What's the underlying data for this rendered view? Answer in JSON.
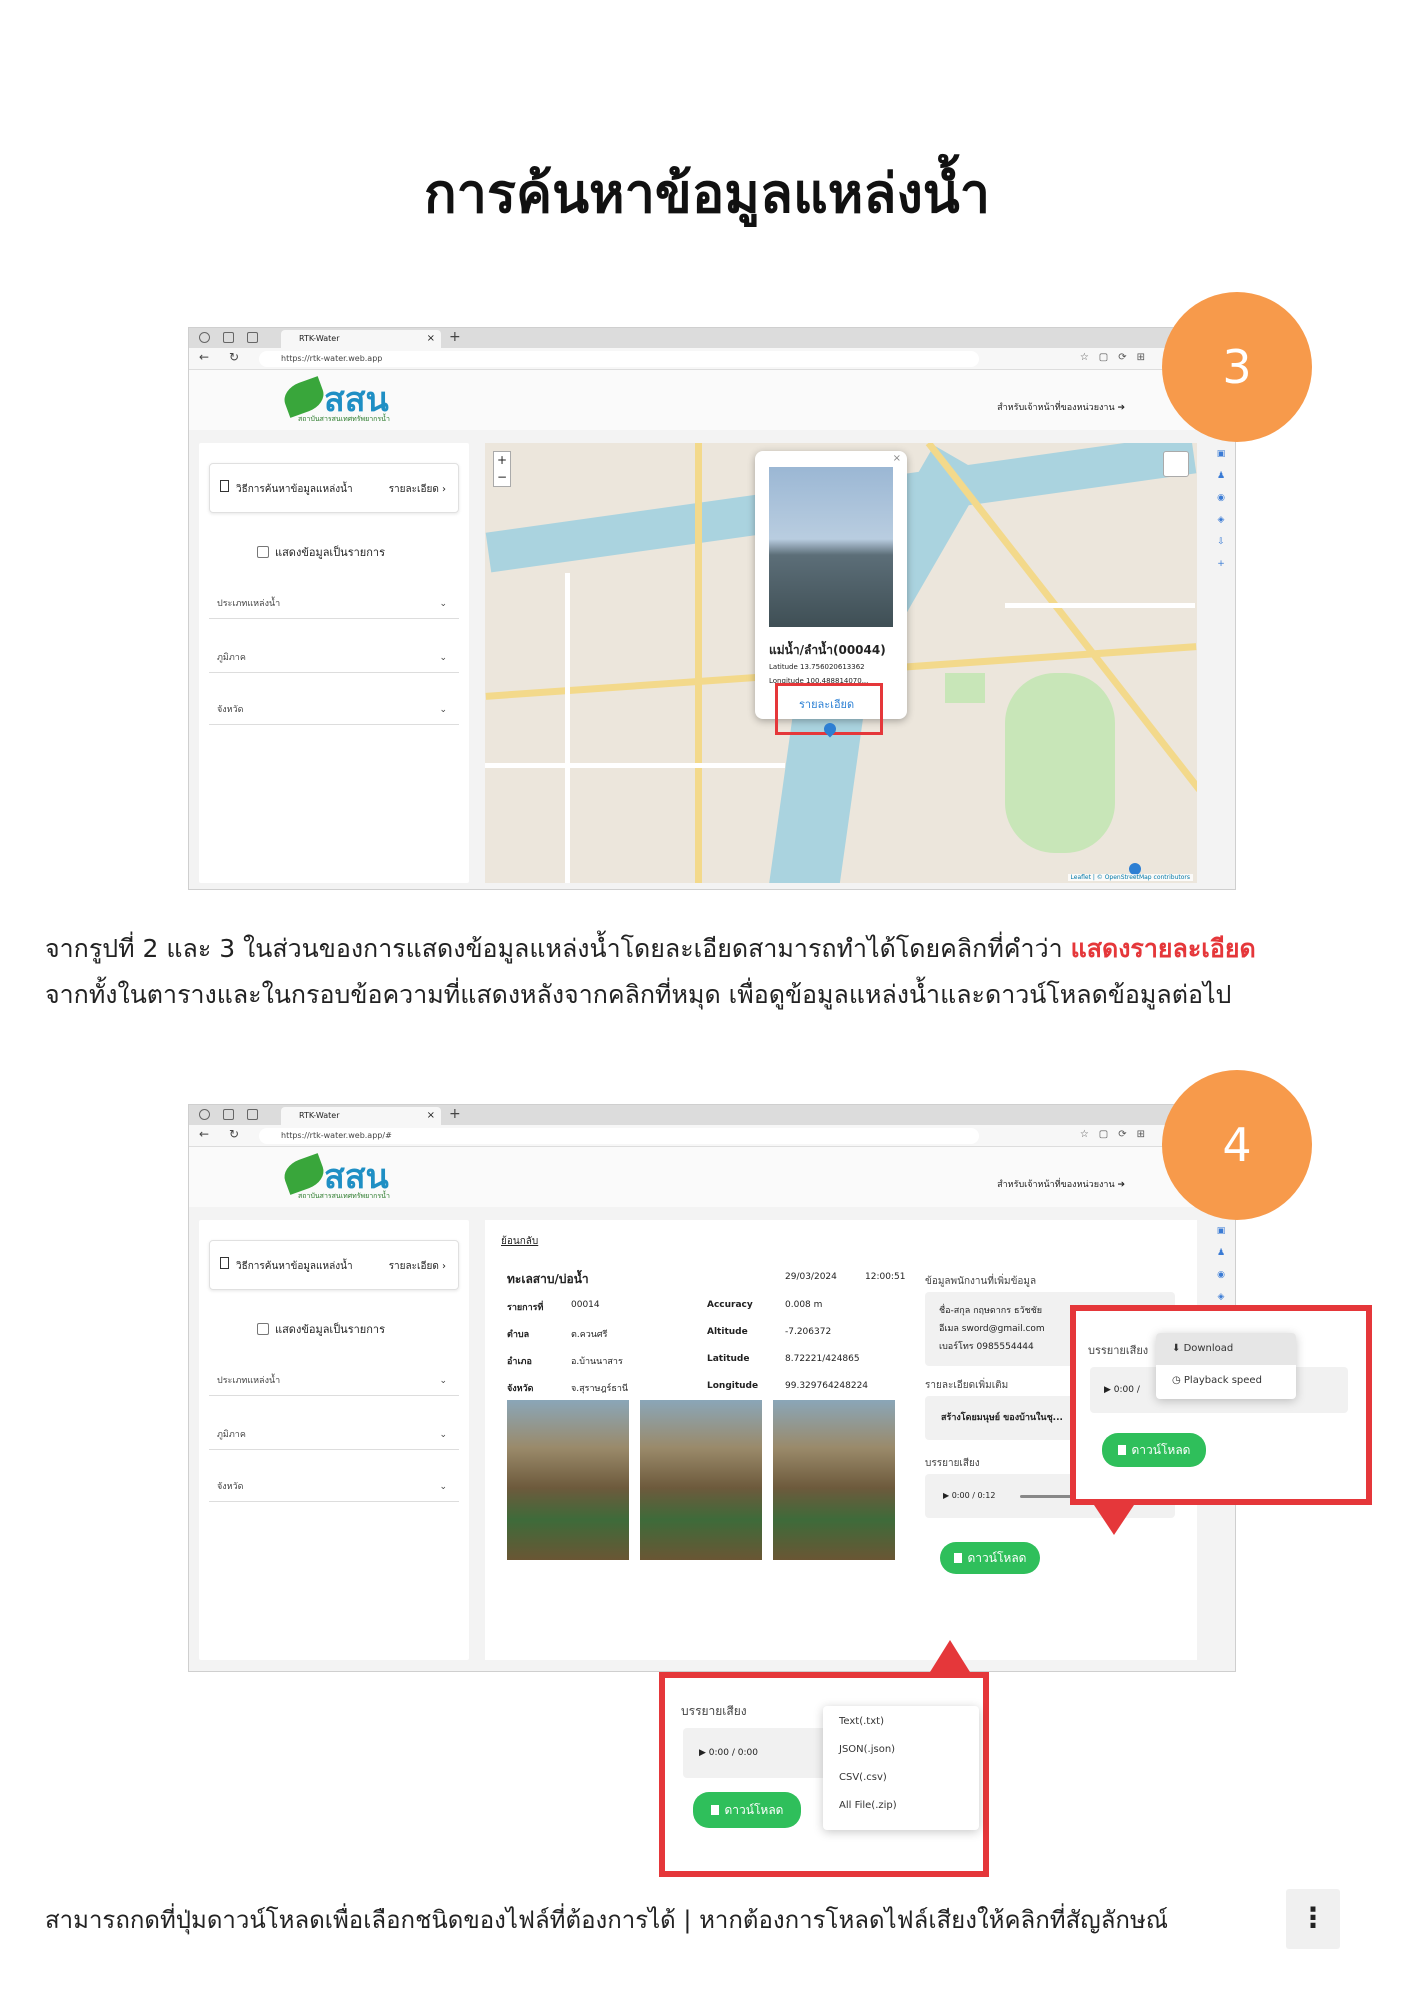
{
  "title": "การค้นหาข้อมูลแหล่งน้ำ",
  "browser": {
    "tab_title": "RTK-Water",
    "url1": "https://rtk-water.web.app",
    "url2": "https://rtk-water.web.app/#"
  },
  "app": {
    "logo_text": "สสน",
    "logo_sub": "สถาบันสารสนเทศทรัพยากรน้ำ",
    "staff_link": "สำหรับเจ้าหน้าที่ของหน่วยงาน",
    "method_label": "วิธีการค้นหาข้อมูลแหล่งน้ำ",
    "method_link": "รายละเอียด",
    "list_toggle": "แสดงข้อมูลเป็นรายการ",
    "selects": [
      "ประเภทแหล่งน้ำ",
      "ภูมิภาค",
      "จังหวัด"
    ]
  },
  "map": {
    "popup_title": "แม่น้ำ/ลำน้ำ(00044)",
    "latitude": "Latitude  13.756020613362",
    "longitude": "Longitude  100.488814070...",
    "detail_link": "รายละเอียด",
    "attribution": "Leaflet | © OpenStreetMap contributors"
  },
  "badges": [
    "3",
    "4"
  ],
  "paragraph1": {
    "text": "จากรูปที่ 2 และ 3 ในส่วนของการแสดงข้อมูลแหล่งน้ำโดยละเอียดสามารถทำได้โดยคลิกที่คำว่า ",
    "highlight": "แสดงรายละเอียด",
    "line2": "จากทั้งในตารางและในกรอบข้อความที่แสดงหลังจากคลิกที่หมุด เพื่อดูข้อมูลแหล่งน้ำและดาวน์โหลดข้อมูลต่อไป"
  },
  "detail": {
    "back": "ย้อนกลับ",
    "title": "ทะเลสาบ/บ่อน้ำ",
    "date": "29/03/2024",
    "time": "12:00:51",
    "left_keys": [
      "รายการที่",
      "ตำบล",
      "อำเภอ",
      "จังหวัด"
    ],
    "left_vals": [
      "00014",
      "ต.ควนศรี",
      "อ.บ้านนาสาร",
      "จ.สุราษฎร์ธานี"
    ],
    "right_keys": [
      "Accuracy",
      "Altitude",
      "Latitude",
      "Longitude"
    ],
    "right_vals": [
      "0.008 m",
      "-7.206372",
      "8.72221/424865",
      "99.329764248224"
    ],
    "staff_head": "ข้อมูลพนักงานที่เพิ่มข้อมูล",
    "staff_name": "ชื่อ-สกุล  กฤษดากร ธวัชชัย",
    "staff_email": "อีเมล  sword@gmail.com",
    "staff_phone": "เบอร์โทร  0985554444",
    "more_head": "รายละเอียดเพิ่มเติม",
    "more_text": "สร้างโดยมนุษย์ ของบ้านในชุ...",
    "audio_head": "บรรยายเสียง",
    "audio_time": "0:00 / 0:12",
    "download": "ดาวน์โหลด"
  },
  "callout_audio": {
    "head": "บรรยายเสียง",
    "time": "0:00 /",
    "menu": [
      "Download",
      "Playback speed"
    ],
    "download": "ดาวน์โหลด"
  },
  "callout_download": {
    "head": "บรรยายเสียง",
    "time": "0:00 / 0:00",
    "menu": [
      "Text(.txt)",
      "JSON(.json)",
      "CSV(.csv)",
      "All File(.zip)"
    ],
    "download": "ดาวน์โหลด"
  },
  "paragraph2": "สามารถกดที่ปุ่มดาวน์โหลดเพื่อเลือกชนิดของไฟล์ที่ต้องการได้ | หากต้องการโหลดไฟล์เสียงให้คลิกที่สัญลักษณ์",
  "kebab": "⋮",
  "colors": {
    "accent_red": "#e5373a",
    "badge_orange": "#f79a4b",
    "download_green": "#2fbf5b"
  }
}
